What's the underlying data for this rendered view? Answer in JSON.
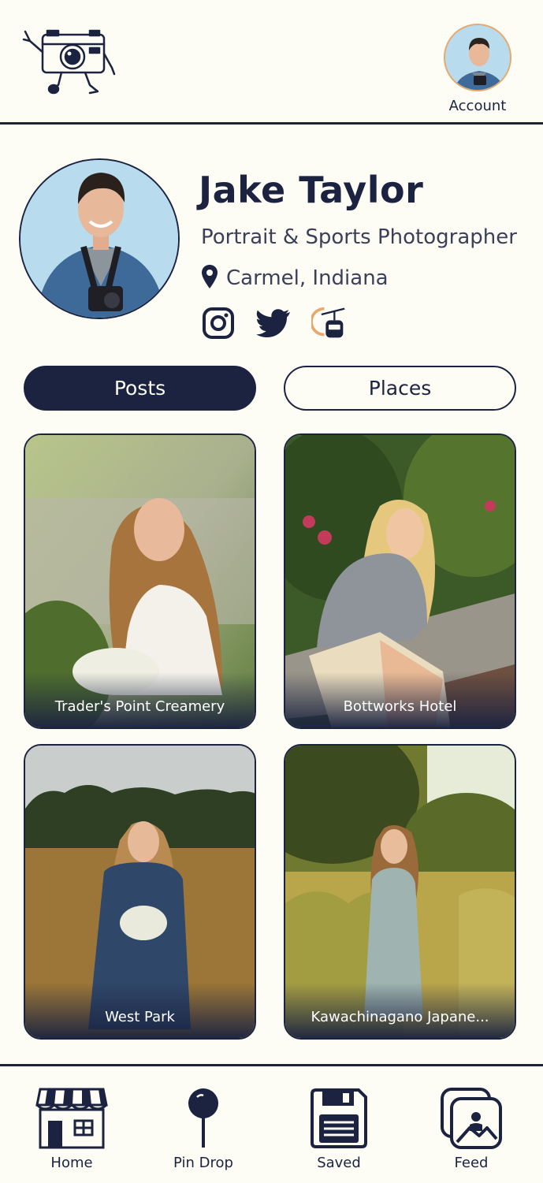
{
  "header": {
    "logo_icon": "camera-mascot-icon",
    "account_label": "Account"
  },
  "profile": {
    "name": "Jake Taylor",
    "role": "Portrait & Sports Photographer",
    "location": "Carmel, Indiana",
    "socials": [
      "instagram-icon",
      "twitter-icon",
      "gondola-icon"
    ]
  },
  "tabs": [
    {
      "label": "Posts",
      "active": true
    },
    {
      "label": "Places",
      "active": false
    }
  ],
  "posts": [
    {
      "caption": "Trader's Point Creamery"
    },
    {
      "caption": "Bottworks Hotel"
    },
    {
      "caption": "West Park"
    },
    {
      "caption": "Kawachinagano Japane..."
    }
  ],
  "nav": [
    {
      "label": "Home",
      "icon": "storefront-icon"
    },
    {
      "label": "Pin Drop",
      "icon": "pin-icon"
    },
    {
      "label": "Saved",
      "icon": "floppy-disk-icon"
    },
    {
      "label": "Feed",
      "icon": "gallery-icon"
    }
  ],
  "colors": {
    "navy": "#1b2340",
    "background": "#fdfcf5",
    "accent": "#e7a96b"
  }
}
